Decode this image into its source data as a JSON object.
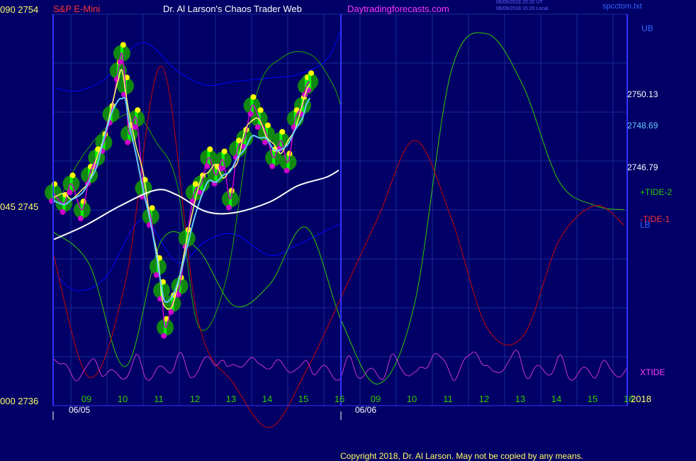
{
  "header": {
    "left_code": "090",
    "left_price": "2754",
    "symbol": "S&P E-Mini",
    "title": "Dr. Al Larson's Chaos Trader Web",
    "site": "Daytradingforecasts.com",
    "stamp_line1": "06/05/2018 20:20 UT",
    "stamp_line2": "06/05/2018 15:20 Local",
    "file": "spcctom.txt"
  },
  "axis_left": [
    {
      "code": "090",
      "price": "2754"
    },
    {
      "code": "045",
      "price": "2745"
    },
    {
      "code": "000",
      "price": "2736"
    }
  ],
  "price_labels": [
    {
      "text": "2750.13",
      "color": "#ffffff"
    },
    {
      "text": "2748.69",
      "color": "#66ccff"
    },
    {
      "text": "2746.79",
      "color": "#ffffff"
    }
  ],
  "band_labels": {
    "ub": "UB",
    "lb": "LB"
  },
  "legend": {
    "tide2": "+TIDE-2",
    "tide1": "-TIDE-1",
    "xtide": "XTIDE"
  },
  "x_hours": [
    "09",
    "10",
    "11",
    "12",
    "13",
    "14",
    "15",
    "16",
    "09",
    "10",
    "11",
    "12",
    "13",
    "14",
    "15",
    "16"
  ],
  "dates": [
    "06/05",
    "06/06"
  ],
  "year": "2018",
  "copyright": "Copyright 2018, Dr. Al Larson. May not be copied by any means.",
  "colors": {
    "background": "#000066",
    "grid": "#1a2a99",
    "price_bar": "#00ff00",
    "marker_high": "#ffff00",
    "marker_low": "#cc00cc",
    "fast_ma": "#ffff66",
    "mid_ma": "#66ccff",
    "slow_ma": "#ffffff",
    "bands": "#0000ff",
    "tide2": "#33cc00",
    "tide1": "#cc0000",
    "xtide": "#cc33cc"
  },
  "chart_data": {
    "type": "line",
    "title": "S&P E-Mini",
    "ylim": [
      2736,
      2754
    ],
    "x_labels": [
      "09",
      "10",
      "11",
      "12",
      "13",
      "14",
      "15",
      "16",
      "09",
      "10",
      "11",
      "12",
      "13",
      "14",
      "15",
      "16"
    ],
    "series": [
      {
        "name": "S&P E-Mini",
        "x": [
          0.0,
          0.3,
          0.5,
          0.8,
          1.0,
          1.2,
          1.4,
          1.6,
          1.8,
          1.9,
          2.0,
          2.1,
          2.3,
          2.5,
          2.7,
          2.9,
          3.0,
          3.1,
          3.3,
          3.5,
          3.7,
          3.9,
          4.1,
          4.3,
          4.5,
          4.7,
          4.9,
          5.1,
          5.3,
          5.5,
          5.7,
          5.9,
          6.1,
          6.3,
          6.5,
          6.7,
          6.9,
          7.0,
          7.1
        ],
        "values": [
          2745.8,
          2745.3,
          2746.2,
          2745.0,
          2746.6,
          2747.4,
          2748.1,
          2749.4,
          2751.4,
          2752.2,
          2750.7,
          2748.5,
          2749.2,
          2746.0,
          2744.7,
          2742.4,
          2741.3,
          2739.6,
          2740.7,
          2741.5,
          2743.7,
          2745.8,
          2746.2,
          2747.4,
          2746.6,
          2747.3,
          2745.5,
          2747.8,
          2748.3,
          2749.8,
          2749.2,
          2748.5,
          2747.4,
          2748.2,
          2747.2,
          2749.2,
          2749.8,
          2750.7,
          2750.9
        ]
      },
      {
        "name": "",
        "x": [
          0,
          1,
          2,
          3,
          4,
          5,
          6,
          7,
          8,
          9,
          10,
          11,
          12,
          13,
          14,
          15,
          15.8
        ],
        "values": [
          2744.0,
          2742.5,
          2737.8,
          2743.6,
          2743.2,
          2740.6,
          2741.6,
          2744.2,
          2739.8,
          2737.0,
          2740.7,
          2751.3,
          2753.1,
          2750.7,
          2746.3,
          2745.2,
          2745.0
        ]
      },
      {
        "name": "",
        "x": [
          0,
          1,
          2,
          3,
          4,
          5,
          6,
          7,
          8,
          9,
          10,
          11,
          12,
          13,
          14,
          15,
          15.8
        ],
        "values": [
          2743.0,
          2737.3,
          2741.7,
          2751.6,
          2740.0,
          2737.0,
          2735.0,
          2737.6,
          2741.1,
          2744.7,
          2748.2,
          2744.7,
          2739.6,
          2739.2,
          2743.6,
          2745.2,
          2744.3
        ]
      },
      {
        "name": "XTIDE",
        "values": []
      }
    ]
  }
}
